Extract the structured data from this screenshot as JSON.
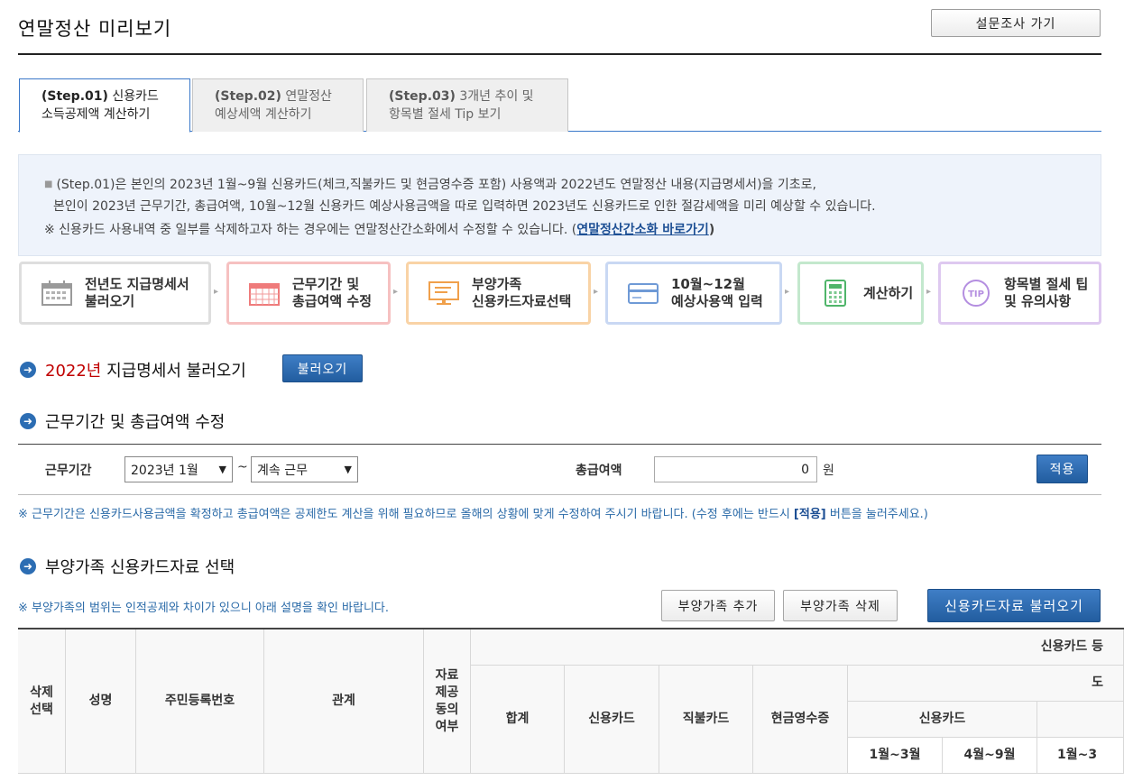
{
  "header": {
    "title": "연말정산 미리보기",
    "survey_button": "설문조사 가기"
  },
  "tabs": [
    {
      "step": "(Step.01)",
      "line1": "신용카드",
      "line2": "소득공제액 계산하기"
    },
    {
      "step": "(Step.02)",
      "line1": "연말정산",
      "line2": "예상세액 계산하기"
    },
    {
      "step": "(Step.03)",
      "line1": "3개년 추이 및",
      "line2": "항목별 절세 Tip 보기"
    }
  ],
  "info": {
    "line1": "(Step.01)은 본인의 2023년 1월~9월 신용카드(체크,직불카드 및 현금영수증 포함) 사용액과 2022년도 연말정산 내용(지급명세서)을 기초로,",
    "line2": "본인이 2023년 근무기간, 총급여액, 10월~12월 신용카드 예상사용금액을 따로 입력하면 2023년도 신용카드로 인한 절감세액을 미리 예상할 수 있습니다.",
    "note_prefix": "※ 신용카드 사용내역 중 일부를 삭제하고자 하는 경우에는 연말정산간소화에서 수정할 수 있습니다. (",
    "note_link": "연말정산간소화 바로가기",
    "note_suffix": ")"
  },
  "steps": [
    {
      "line1": "전년도 지급명세서",
      "line2": "불러오기",
      "icon": "calendar-icon",
      "color": "#d9d9d9"
    },
    {
      "line1": "근무기간 및",
      "line2": "총급여액 수정",
      "icon": "calendar-grid-icon",
      "color": "#f4b9b9"
    },
    {
      "line1": "부양가족",
      "line2": "신용카드자료선택",
      "icon": "monitor-icon",
      "color": "#f9d3a6"
    },
    {
      "line1": "10월~12월",
      "line2": "예상사용액 입력",
      "icon": "credit-card-icon",
      "color": "#c5d6f2"
    },
    {
      "line1": "계산하기",
      "line2": "",
      "icon": "calculator-icon",
      "color": "#bfe6c9"
    },
    {
      "line1": "항목별 절세 팁",
      "line2": "및 유의사항",
      "icon": "tip-icon",
      "color": "#dcc7ef"
    }
  ],
  "section1": {
    "year": "2022년",
    "title": "지급명세서 불러오기",
    "button": "불러오기"
  },
  "section2": {
    "title": "근무기간 및 총급여액 수정",
    "period_label": "근무기간",
    "period_start": "2023년 1월",
    "tilde": "~",
    "period_end": "계속 근무",
    "salary_label": "총급여액",
    "salary_value": "0",
    "unit": "원",
    "apply_button": "적용",
    "note_prefix": "※ 근무기간은 신용카드사용금액을 확정하고 총급여액은 공제한도 계산을 위해 필요하므로 올해의 상황에 맞게 수정하여 주시기 바랍니다. (수정 후에는 반드시 ",
    "note_bold": "[적용]",
    "note_suffix": " 버튼을 눌러주세요.)"
  },
  "section3": {
    "title": "부양가족 신용카드자료 선택",
    "note": "※ 부양가족의 범위는 인적공제와 차이가 있으니 아래 설명을 확인 바랍니다.",
    "add_button": "부양가족 추가",
    "delete_button": "부양가족 삭제",
    "load_button": "신용카드자료 불러오기"
  },
  "table": {
    "delete_select": "삭제\n선택",
    "name": "성명",
    "rrn": "주민등록번호",
    "relation": "관계",
    "consent": "자료\n제공\n동의\n여부",
    "card_group": "신용카드 등",
    "sub_group": "도",
    "total": "합계",
    "credit": "신용카드",
    "debit": "직불카드",
    "cash": "현금영수증",
    "credit_sub": "신용카드",
    "m1": "1월~3월",
    "m2": "4월~9월",
    "m3": "1월~3"
  }
}
